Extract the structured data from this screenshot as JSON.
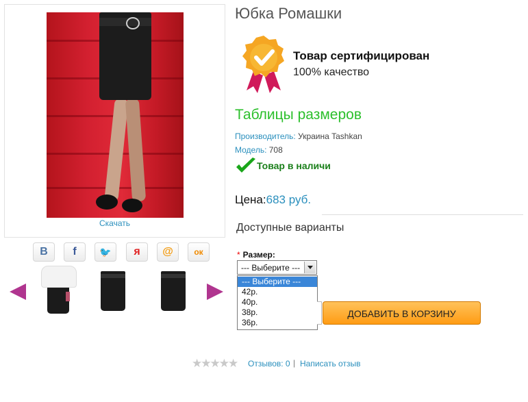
{
  "product": {
    "title": "Юбка Ромашки",
    "image_link": "Скачать"
  },
  "share_buttons": [
    {
      "icon": "vk-icon",
      "glyph": "B",
      "color": "#4b73a4"
    },
    {
      "icon": "facebook-icon",
      "glyph": "f",
      "color": "#3b5998"
    },
    {
      "icon": "twitter-icon",
      "glyph": "🐦",
      "color": "#2aa9e0"
    },
    {
      "icon": "yaru-icon",
      "glyph": "я",
      "color": "#e02020"
    },
    {
      "icon": "mailru-icon",
      "glyph": "@",
      "color": "#f39c12"
    },
    {
      "icon": "odnoklassniki-icon",
      "glyph": "ок",
      "color": "#f08a00"
    }
  ],
  "thumbnails": [
    "thumb-1",
    "thumb-2",
    "thumb-3"
  ],
  "certificate": {
    "title": "Товар сертифицирован",
    "subtitle": "100% качество",
    "badge_color": "#f5a623",
    "ribbon_color": "#d01a5a"
  },
  "size_table_link": "Таблицы размеров",
  "info": {
    "manufacturer_label": "Производитель:",
    "manufacturer_value": "Украина Tashkan",
    "model_label": "Модель:",
    "model_value": "708"
  },
  "stock": {
    "text": "Товар в наличи",
    "check_color": "#1aa61a"
  },
  "price": {
    "label": "Цена:",
    "value": "683 руб."
  },
  "variants": {
    "heading": "Доступные варианты",
    "size_label": "Размер:",
    "required_mark": "*",
    "selected": "--- Выберите ---",
    "options": [
      "--- Выберите ---",
      "42р.",
      "40р.",
      "38р.",
      "36р."
    ]
  },
  "cart_button": "ДОБАВИТЬ В КОРЗИНУ",
  "reviews": {
    "rating_stars": 0,
    "max_stars": 5,
    "reviews_link": "Отзывов: 0",
    "separator": "|",
    "write_link": "Написать отзыв"
  }
}
